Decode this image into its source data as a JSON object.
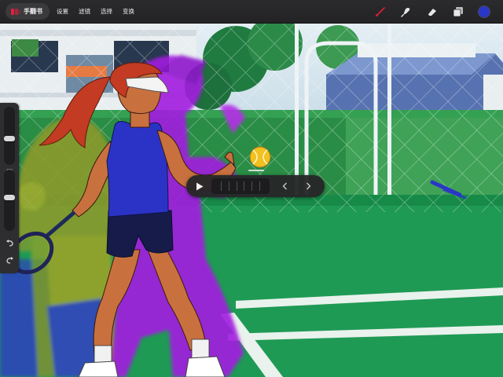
{
  "app": {
    "gallery_label": "手翻书",
    "gallery_icon": "flipbook-app-icon"
  },
  "menu": {
    "items": [
      {
        "label": "设置",
        "name": "menu-settings"
      },
      {
        "label": "滤镜",
        "name": "menu-adjustments"
      },
      {
        "label": "选择",
        "name": "menu-selection"
      },
      {
        "label": "变换",
        "name": "menu-transform"
      }
    ]
  },
  "tools": {
    "active_tool": "brush",
    "items": [
      "brush-icon",
      "smudge-icon",
      "eraser-icon",
      "layers-icon"
    ],
    "current_color": "#2a36c7",
    "active_tool_color": "#e0203a"
  },
  "sidebar": {
    "brush_size_level": 0.55,
    "opacity_level": 0.45,
    "undo_icon": "undo-icon",
    "redo_icon": "redo-icon"
  },
  "playback": {
    "play_icon": "play-icon",
    "frame_count": 6,
    "prev_icon": "chevron-left-icon",
    "next_icon": "chevron-right-icon"
  },
  "canvas": {
    "subject": "tennis-player-onion-skin-animation",
    "palette": {
      "court_green": "#1f9a55",
      "hedge_green": "#2a8d46",
      "sky": "#cfe2ee",
      "fence": "#dfe8ef",
      "shirt_blue": "#2b33c6",
      "shorts_navy": "#161b4a",
      "hair_red": "#c23b22",
      "skin": "#c8713f",
      "onion_purple": "#a21fe0",
      "onion_olive": "#9fa425",
      "ball_yellow": "#f2c11f"
    }
  }
}
